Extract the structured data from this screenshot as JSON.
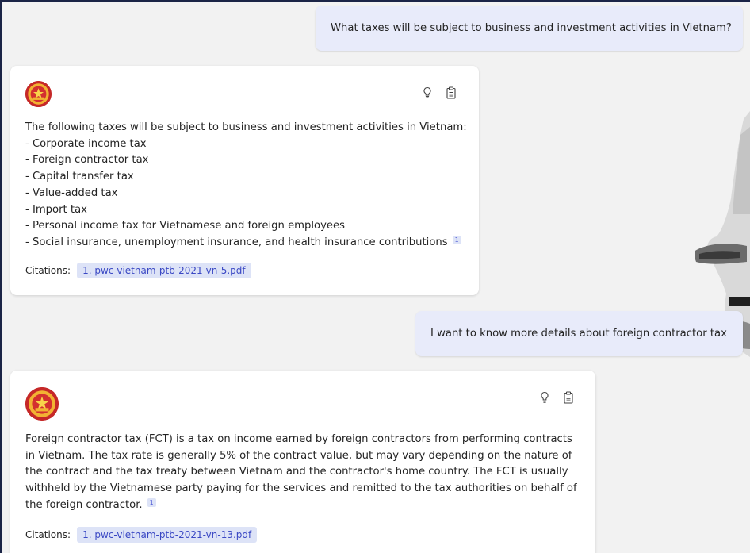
{
  "conversation": {
    "messages": [
      {
        "role": "user",
        "text": "What taxes will be subject to business and investment activities in Vietnam?"
      },
      {
        "role": "assistant",
        "lines": [
          "The following taxes will be subject to business and investment activities in Vietnam:",
          "- Corporate income tax",
          "- Foreign contractor tax",
          "- Capital transfer tax",
          "- Value-added tax",
          "- Import tax",
          "- Personal income tax for Vietnamese and foreign employees",
          "- Social insurance, unemployment insurance, and health insurance contributions"
        ],
        "footnote": "1",
        "citations_label": "Citations:",
        "citation": "1. pwc-vietnam-ptb-2021-vn-5.pdf",
        "avatar_icon": "vietnam-emblem-icon"
      },
      {
        "role": "user",
        "text": "I want to know more details about foreign contractor tax"
      },
      {
        "role": "assistant",
        "lines": [
          "Foreign contractor tax (FCT) is a tax on income earned by foreign contractors from performing contracts",
          "in Vietnam. The tax rate is generally 5% of the contract value, but may vary depending on the nature of",
          "the contract and the tax treaty between Vietnam and the contractor's home country. The FCT is usually",
          "withheld by the Vietnamese party paying for the services and remitted to the tax authorities on behalf of",
          "the foreign contractor."
        ],
        "footnote": "1",
        "citations_label": "Citations:",
        "citation": "1. pwc-vietnam-ptb-2021-vn-13.pdf",
        "avatar_icon": "vietnam-emblem-icon"
      }
    ]
  },
  "icons": {
    "idea": "lightbulb-icon",
    "copy": "clipboard-icon"
  },
  "colors": {
    "user_bubble": "#e8ebfa",
    "card": "#ffffff",
    "background": "#f2f2f2",
    "citation_chip": "#dde3f7",
    "citation_text": "#3a48c4",
    "frame": "#1b2446"
  }
}
